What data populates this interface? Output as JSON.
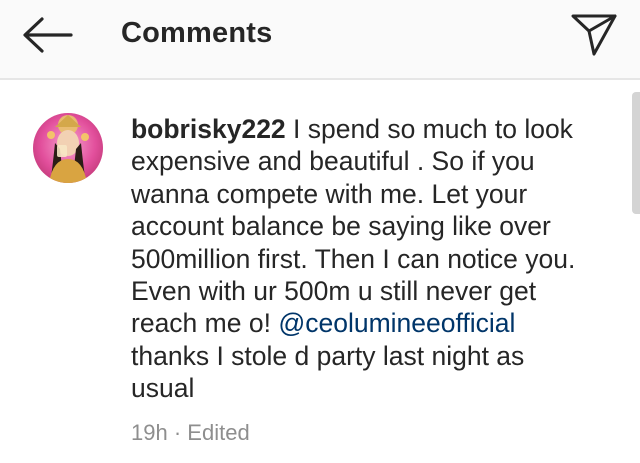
{
  "header": {
    "title": "Comments",
    "back_icon": "arrow-left-icon",
    "send_icon": "paper-plane-icon"
  },
  "comment": {
    "username": "bobrisky222",
    "text_before_mention": "I spend so much to look expensive and beautiful . So if you wanna compete with me. Let your account balance be saying like over 500million first. Then I can notice you. Even with ur 500m u still never get reach me o!",
    "mention": "@ceolumineeofficial",
    "text_after_mention": "thanks I stole d party last night as usual",
    "time": "19h",
    "separator": "·",
    "status": "Edited"
  },
  "colors": {
    "header_background": "#fafafa",
    "text": "#262626",
    "mention": "#003569",
    "meta": "#8e8e8e",
    "avatar_background": "#e24f9c"
  }
}
